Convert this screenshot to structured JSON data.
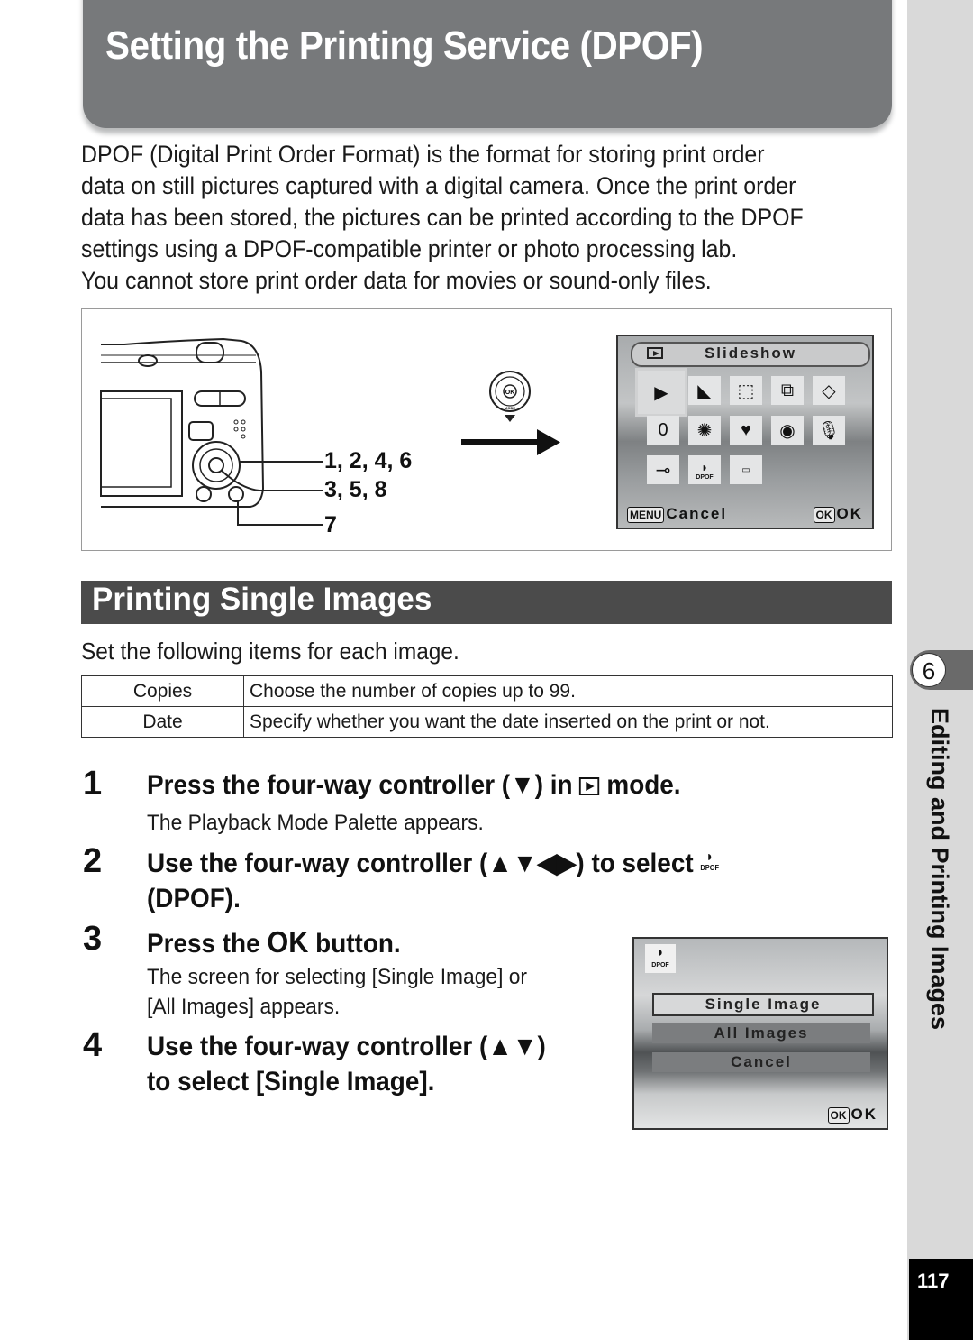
{
  "page": {
    "title": "Setting the Printing Service (DPOF)",
    "intro": [
      "DPOF (Digital Print Order Format) is the format for storing print order",
      "data on still pictures captured with a digital camera. Once the print order",
      "data has been stored, the pictures can be printed according to the DPOF",
      "settings using a DPOF-compatible printer or photo processing lab.",
      "You cannot store print order data for movies or sound-only files."
    ],
    "page_number": "117"
  },
  "figure": {
    "callouts": [
      "1, 2, 4, 6",
      "3, 5, 8",
      "7"
    ],
    "controller_labels": {
      "center": "OK",
      "bottom": "MODE"
    },
    "palette_screen": {
      "header_title": "Slideshow",
      "icons": [
        [
          "slideshow-icon",
          "resize-icon",
          "cropping-icon",
          "image-copy-icon",
          "rotate-icon"
        ],
        [
          "digital-filter-icon",
          "brightness-filter-icon",
          "frame-composite-icon",
          "red-eye-edit-icon",
          "voice-memo-icon"
        ],
        [
          "protect-icon",
          "dpof-icon",
          "start-up-screen-icon"
        ]
      ],
      "dpof_icon_label": "DPOF",
      "footer_left_key": "MENU",
      "footer_left_label": "Cancel",
      "footer_right_key": "OK",
      "footer_right_label": "OK"
    }
  },
  "section": {
    "title": "Printing Single Images",
    "lead": "Set the following items for each image.",
    "table": [
      {
        "item": "Copies",
        "description": "Choose the number of copies up to 99."
      },
      {
        "item": "Date",
        "description": "Specify whether you want the date inserted on the print or not."
      }
    ]
  },
  "steps": [
    {
      "num": "1",
      "head_pre": "Press the four-way controller (▼) in",
      "head_post": "mode.",
      "desc": "The Playback Mode Palette appears."
    },
    {
      "num": "2",
      "head_pre": "Use the four-way controller (▲▼◀▶) to select",
      "head_line2": "(DPOF)."
    },
    {
      "num": "3",
      "head_pre": "Press the",
      "head_ok": "OK",
      "head_post": "button.",
      "desc_lines": [
        "The screen for selecting [Single Image] or",
        "[All Images] appears."
      ]
    },
    {
      "num": "4",
      "head_lines": [
        "Use the four-way controller (▲▼)",
        "to select [Single Image]."
      ]
    }
  ],
  "dpof_screen": {
    "icon_label": "DPOF",
    "options": [
      "Single Image",
      "All Images",
      "Cancel"
    ],
    "selected": "Single Image",
    "footer_key": "OK",
    "footer_label": "OK"
  },
  "sidebar": {
    "chapter_number": "6",
    "chapter_title": "Editing and Printing Images"
  }
}
